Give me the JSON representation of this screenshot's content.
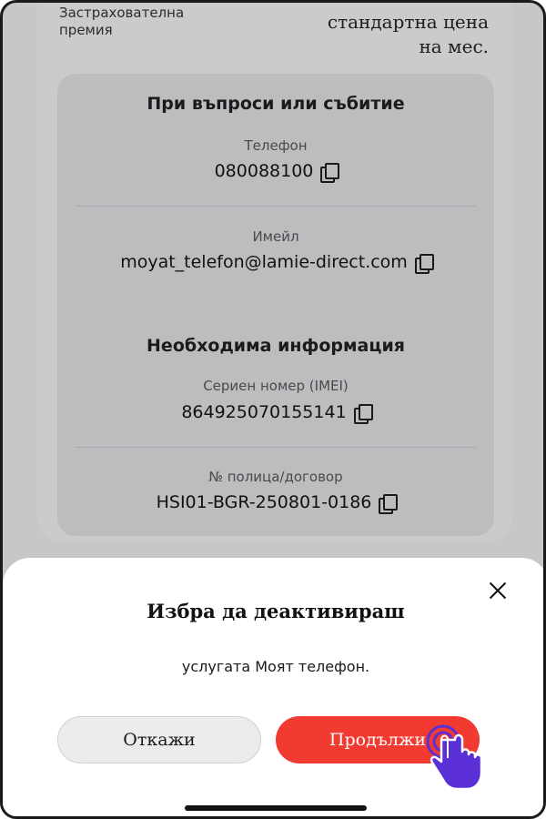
{
  "background": {
    "premium_label": "Застраховатeлна\nпремия",
    "price_label": "стандартна цена\nна мес."
  },
  "info": {
    "contact_title": "При въпроси или събитие",
    "phone_label": "Телефон",
    "phone_value": "080088100",
    "email_label": "Имейл",
    "email_value": "moyat_telefon@lamie-direct.com",
    "required_title": "Необходима информация",
    "imei_label": "Сериен номер (IMEI)",
    "imei_value": "864925070155141",
    "policy_label": "№ полица/договор",
    "policy_value": "HSI01-BGR-250801-0186"
  },
  "sheet": {
    "title": "Избра да деактивираш",
    "description": "услугата Моят телефон.",
    "cancel_label": "Откажи",
    "continue_label": "Продължи"
  },
  "colors": {
    "accent": "#f13a30",
    "pointer": "#5b2fd6"
  },
  "icons": [
    "copy-icon",
    "close-icon",
    "hand-pointer-icon"
  ]
}
